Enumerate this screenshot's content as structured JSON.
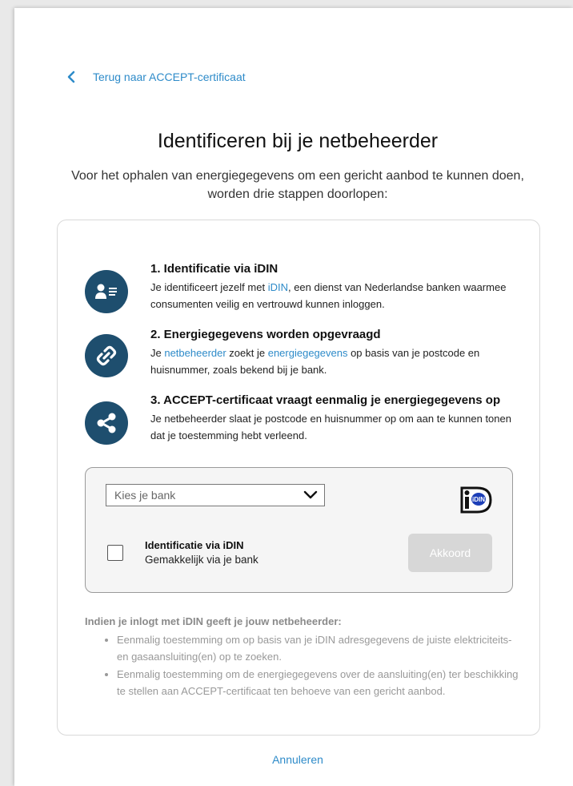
{
  "nav": {
    "back_label": "Terug naar ACCEPT-certificaat"
  },
  "header": {
    "title": "Identificeren bij je netbeheerder",
    "subtitle_line1": "Voor het ophalen van energiegegevens om een gericht aanbod te kunnen doen,",
    "subtitle_line2": "worden drie stappen doorlopen:"
  },
  "steps": [
    {
      "title": "1. Identificatie via iDIN",
      "text_before": "Je identificeert jezelf met ",
      "link1": "iDIN",
      "text_after": ", een dienst van Nederlandse banken waarmee consumenten veilig en vertrouwd kunnen inloggen.",
      "icon": "id-card-icon"
    },
    {
      "title": "2. Energiegegevens worden opgevraagd",
      "text_before": "Je ",
      "link1": "netbeheerder",
      "text_middle": " zoekt je ",
      "link2": "energiegegevens",
      "text_after": " op basis van je postcode en huisnummer, zoals bekend bij je bank.",
      "icon": "link-icon"
    },
    {
      "title": "3. ACCEPT-certificaat vraagt eenmalig je energiegegevens op",
      "text": "Je netbeheerder slaat je postcode en huisnummer op om aan te kunnen tonen dat je toestemming hebt verleend.",
      "icon": "share-icon"
    }
  ],
  "bank": {
    "select_placeholder": "Kies je bank",
    "logo_text": "iDIN",
    "checkbox_title": "Identificatie via iDIN",
    "checkbox_subtitle": "Gemakkelijk via je bank",
    "checkbox_checked": false,
    "accept_label": "Akkoord"
  },
  "info": {
    "heading": "Indien je inlogt met iDIN geeft je jouw netbeheerder:",
    "bullets": [
      "Eenmalig toestemming om op basis van je iDIN adresgegevens de juiste elektriciteits- en gasaansluiting(en) op te zoeken.",
      "Eenmalig toestemming om de energiegegevens over de aansluiting(en) ter beschikking te stellen aan ACCEPT-certificaat ten behoeve van een gericht aanbod."
    ]
  },
  "footer": {
    "cancel_label": "Annuleren"
  },
  "colors": {
    "accent": "#2e8bc9",
    "icon_bg": "#1e4e6e",
    "button_disabled": "#d7d7d7"
  }
}
